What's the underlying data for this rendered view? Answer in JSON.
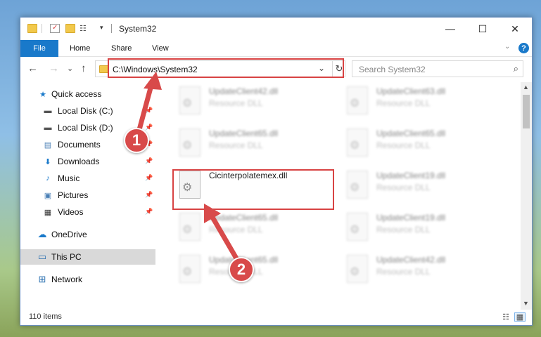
{
  "window": {
    "title": "System32",
    "minimize_glyph": "—",
    "maximize_glyph": "☐",
    "close_glyph": "✕"
  },
  "ribbon": {
    "file_label": "File",
    "tabs": [
      "Home",
      "Share",
      "View"
    ],
    "help_glyph": "?",
    "expand_glyph": "⌄"
  },
  "nav_buttons": {
    "back": "←",
    "forward": "→",
    "recent": "⌄",
    "up": "↑"
  },
  "address": {
    "path": "C:\\Windows\\System32",
    "chevron": "⌄",
    "refresh_glyph": "↻"
  },
  "search": {
    "placeholder": "Search System32",
    "icon_glyph": "⌕"
  },
  "sidebar": {
    "items": [
      {
        "label": "Quick access",
        "icon": "star-icon",
        "glyph": "★",
        "pinned": false
      },
      {
        "label": "Local Disk (C:)",
        "icon": "drive-icon",
        "glyph": "▬",
        "pinned": true
      },
      {
        "label": "Local Disk (D:)",
        "icon": "drive-icon",
        "glyph": "▬",
        "pinned": true
      },
      {
        "label": "Documents",
        "icon": "documents-icon",
        "glyph": "▤",
        "pinned": true
      },
      {
        "label": "Downloads",
        "icon": "downloads-icon",
        "glyph": "⬇",
        "pinned": true
      },
      {
        "label": "Music",
        "icon": "music-icon",
        "glyph": "♪",
        "pinned": true
      },
      {
        "label": "Pictures",
        "icon": "pictures-icon",
        "glyph": "▣",
        "pinned": true
      },
      {
        "label": "Videos",
        "icon": "videos-icon",
        "glyph": "▦",
        "pinned": true
      },
      {
        "label": "OneDrive",
        "icon": "cloud-icon",
        "glyph": "☁",
        "pinned": false
      },
      {
        "label": "This PC",
        "icon": "computer-icon",
        "glyph": "▭",
        "pinned": false,
        "selected": true
      },
      {
        "label": "Network",
        "icon": "network-icon",
        "glyph": "⊞",
        "pinned": false
      }
    ],
    "pin_glyph": "📌"
  },
  "files": [
    {
      "name": "UpdateClient42.dll",
      "type": "Resource DLL",
      "blurred": true
    },
    {
      "name": "UpdateClient63.dll",
      "type": "Resource DLL",
      "blurred": true
    },
    {
      "name": "UpdateClient65.dll",
      "type": "Resource DLL",
      "blurred": true
    },
    {
      "name": "UpdateClient65.dll",
      "type": "Resource DLL",
      "blurred": true
    },
    {
      "name": "Cicinterpolatemex.dll",
      "type": "",
      "blurred": false
    },
    {
      "name": "UpdateClient19.dll",
      "type": "Resource DLL",
      "blurred": true
    },
    {
      "name": "UpdateClient65.dll",
      "type": "Resource DLL",
      "blurred": true
    },
    {
      "name": "UpdateClient19.dll",
      "type": "Resource DLL",
      "blurred": true
    },
    {
      "name": "UpdateClient65.dll",
      "type": "Resource DLL",
      "blurred": true
    },
    {
      "name": "UpdateClient42.dll",
      "type": "Resource DLL",
      "blurred": true
    }
  ],
  "gear_glyph": "⚙",
  "status": {
    "item_count": "110 items"
  },
  "callouts": [
    "1",
    "2"
  ],
  "colors": {
    "accent": "#1979ca",
    "highlight": "#d84343",
    "callout": "#d84a4a"
  }
}
